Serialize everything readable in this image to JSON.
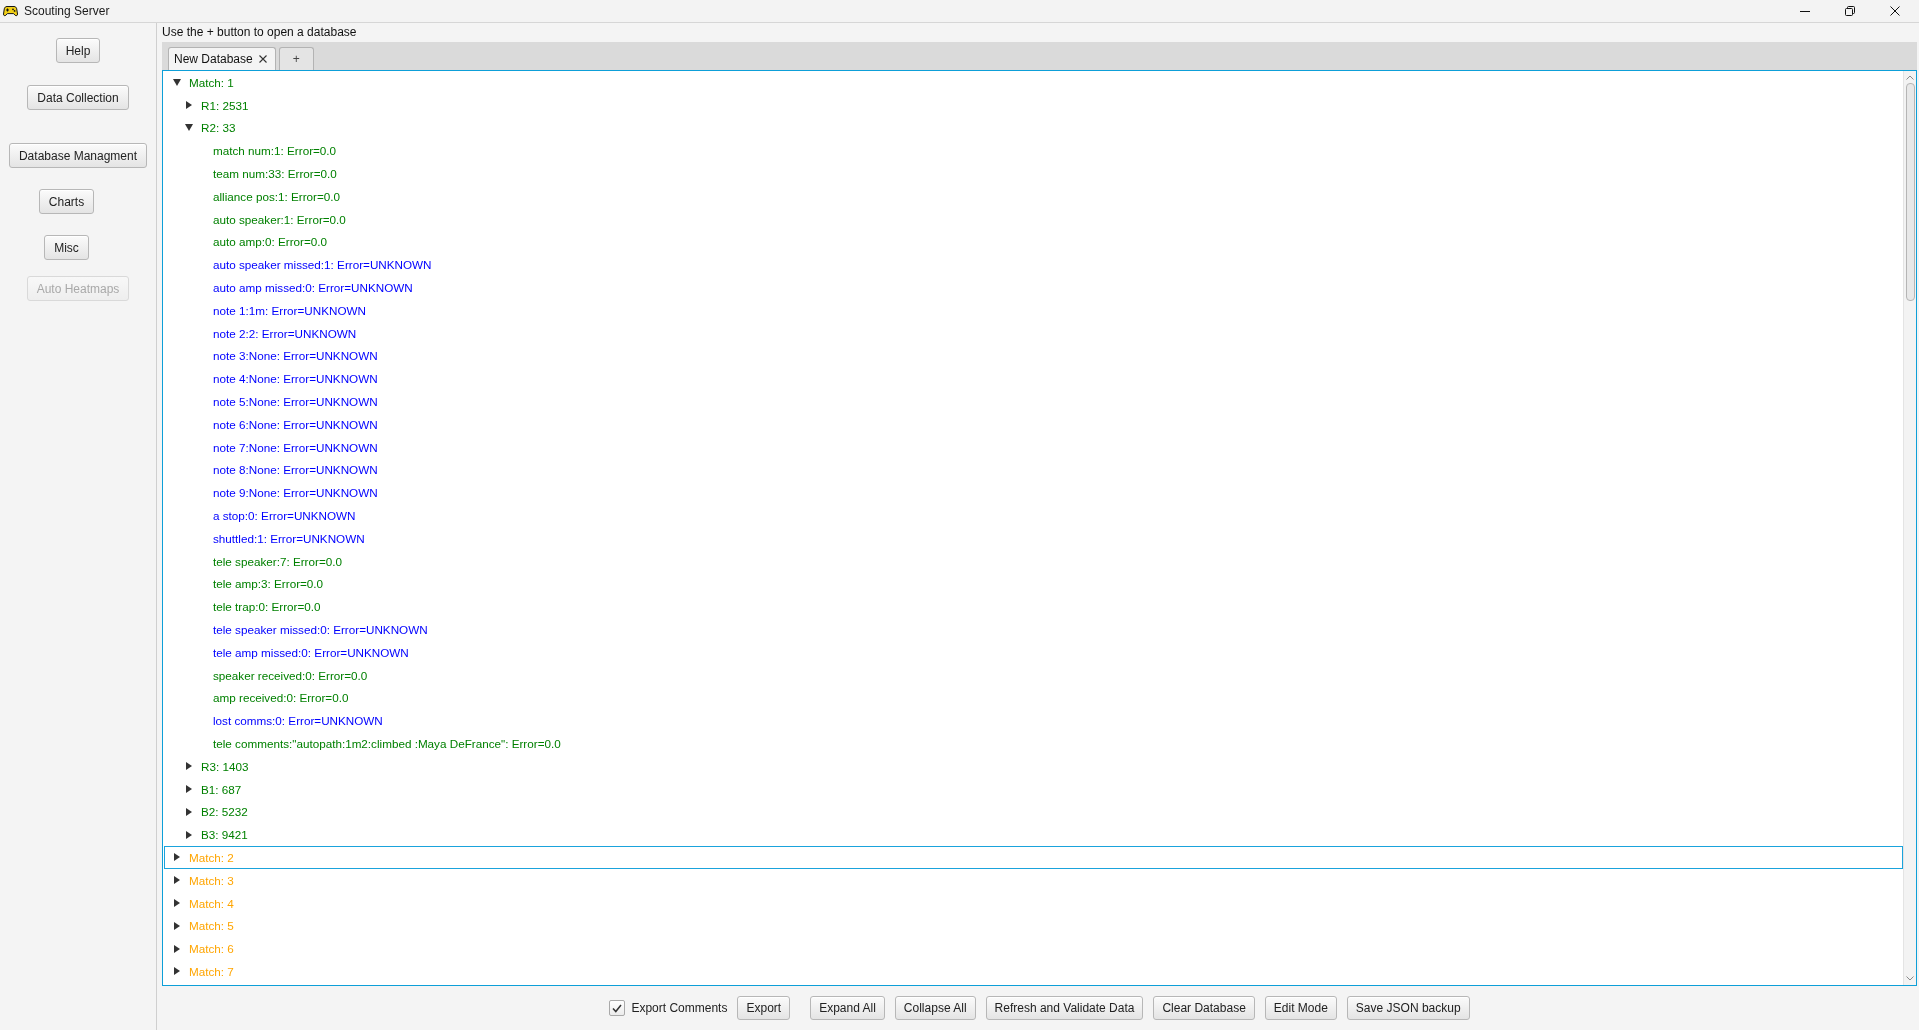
{
  "window": {
    "title": "Scouting Server"
  },
  "sidebar": {
    "buttons": [
      {
        "label": "Help",
        "disabled": false
      },
      {
        "label": "Data Collection",
        "disabled": false
      },
      {
        "label": "Database Managment",
        "disabled": false
      },
      {
        "label": "Charts",
        "disabled": false
      },
      {
        "label": "Misc",
        "disabled": false
      },
      {
        "label": "Auto Heatmaps",
        "disabled": true
      }
    ]
  },
  "hint": "Use the + button to open a database",
  "tabs": [
    {
      "label": "New Database",
      "selected": true,
      "closable": true
    },
    {
      "label": "+",
      "selected": false,
      "closable": false
    }
  ],
  "tree": {
    "nodes": [
      {
        "label": "Match: 1",
        "color": "#008000",
        "expanded": true,
        "selected": false,
        "children": [
          {
            "label": "R1: 2531",
            "color": "#008000",
            "expanded": false,
            "selected": false
          },
          {
            "label": "R2: 33",
            "color": "#008000",
            "expanded": true,
            "selected": false,
            "children": [
              {
                "label": "match num:1: Error=0.0",
                "color": "#008000",
                "selected": false
              },
              {
                "label": "team num:33: Error=0.0",
                "color": "#008000",
                "selected": false
              },
              {
                "label": "alliance pos:1: Error=0.0",
                "color": "#008000",
                "selected": false
              },
              {
                "label": "auto speaker:1: Error=0.0",
                "color": "#008000",
                "selected": false
              },
              {
                "label": "auto amp:0: Error=0.0",
                "color": "#008000",
                "selected": false
              },
              {
                "label": "auto speaker missed:1: Error=UNKNOWN",
                "color": "#0000ff",
                "selected": false
              },
              {
                "label": "auto amp missed:0: Error=UNKNOWN",
                "color": "#0000ff",
                "selected": false
              },
              {
                "label": "note 1:1m: Error=UNKNOWN",
                "color": "#0000ff",
                "selected": false
              },
              {
                "label": "note 2:2: Error=UNKNOWN",
                "color": "#0000ff",
                "selected": false
              },
              {
                "label": "note 3:None: Error=UNKNOWN",
                "color": "#0000ff",
                "selected": false
              },
              {
                "label": "note 4:None: Error=UNKNOWN",
                "color": "#0000ff",
                "selected": false
              },
              {
                "label": "note 5:None: Error=UNKNOWN",
                "color": "#0000ff",
                "selected": false
              },
              {
                "label": "note 6:None: Error=UNKNOWN",
                "color": "#0000ff",
                "selected": false
              },
              {
                "label": "note 7:None: Error=UNKNOWN",
                "color": "#0000ff",
                "selected": false
              },
              {
                "label": "note 8:None: Error=UNKNOWN",
                "color": "#0000ff",
                "selected": false
              },
              {
                "label": "note 9:None: Error=UNKNOWN",
                "color": "#0000ff",
                "selected": false
              },
              {
                "label": "a stop:0: Error=UNKNOWN",
                "color": "#0000ff",
                "selected": false
              },
              {
                "label": "shuttled:1: Error=UNKNOWN",
                "color": "#0000ff",
                "selected": false
              },
              {
                "label": "tele speaker:7: Error=0.0",
                "color": "#008000",
                "selected": false
              },
              {
                "label": "tele amp:3: Error=0.0",
                "color": "#008000",
                "selected": false
              },
              {
                "label": "tele trap:0: Error=0.0",
                "color": "#008000",
                "selected": false
              },
              {
                "label": "tele speaker missed:0: Error=UNKNOWN",
                "color": "#0000ff",
                "selected": false
              },
              {
                "label": "tele amp missed:0: Error=UNKNOWN",
                "color": "#0000ff",
                "selected": false
              },
              {
                "label": "speaker received:0: Error=0.0",
                "color": "#008000",
                "selected": false
              },
              {
                "label": "amp received:0: Error=0.0",
                "color": "#008000",
                "selected": false
              },
              {
                "label": "lost comms:0: Error=UNKNOWN",
                "color": "#0000ff",
                "selected": false
              },
              {
                "label": "tele comments:\"autopath:1m2:climbed :Maya DeFrance\": Error=0.0",
                "color": "#008000",
                "selected": false
              }
            ]
          },
          {
            "label": "R3: 1403",
            "color": "#008000",
            "expanded": false,
            "selected": false
          },
          {
            "label": "B1: 687",
            "color": "#008000",
            "expanded": false,
            "selected": false
          },
          {
            "label": "B2: 5232",
            "color": "#008000",
            "expanded": false,
            "selected": false
          },
          {
            "label": "B3: 9421",
            "color": "#008000",
            "expanded": false,
            "selected": false
          }
        ]
      },
      {
        "label": "Match: 2",
        "color": "#ffa500",
        "expanded": false,
        "selected": true
      },
      {
        "label": "Match: 3",
        "color": "#ffa500",
        "expanded": false,
        "selected": false
      },
      {
        "label": "Match: 4",
        "color": "#ffa500",
        "expanded": false,
        "selected": false
      },
      {
        "label": "Match: 5",
        "color": "#ffa500",
        "expanded": false,
        "selected": false
      },
      {
        "label": "Match: 6",
        "color": "#ffa500",
        "expanded": false,
        "selected": false
      },
      {
        "label": "Match: 7",
        "color": "#ffa500",
        "expanded": false,
        "selected": false
      }
    ]
  },
  "footer": {
    "export_comments": {
      "label": "Export Comments",
      "checked": true
    },
    "buttons": [
      "Export",
      "Expand All",
      "Collapse All",
      "Refresh and Validate Data",
      "Clear Database",
      "Edit Mode",
      "Save JSON backup"
    ]
  }
}
